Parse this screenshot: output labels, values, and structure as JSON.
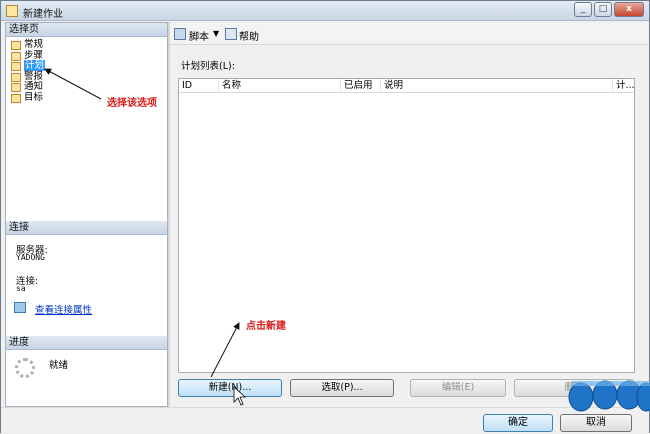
{
  "window": {
    "title": "新建作业"
  },
  "left_pane": {
    "select_page_header": "选择页",
    "pages": [
      {
        "label": "常规",
        "selected": false
      },
      {
        "label": "步骤",
        "selected": false
      },
      {
        "label": "计划",
        "selected": true
      },
      {
        "label": "警报",
        "selected": false
      },
      {
        "label": "通知",
        "selected": false
      },
      {
        "label": "目标",
        "selected": false
      }
    ],
    "connection_header": "连接",
    "server_label": "服务器:",
    "server_value": "YADONG",
    "connection_label": "连接:",
    "connection_value": "sa",
    "view_connection_link": "查看连接属性",
    "progress_header": "进度",
    "progress_status": "就绪"
  },
  "toolbar": {
    "script_label": "脚本",
    "help_label": "帮助"
  },
  "main": {
    "list_label": "计划列表(L):",
    "columns": [
      "ID",
      "名称",
      "已启用",
      "说明",
      "计..."
    ],
    "buttons": {
      "new": "新建(N)...",
      "pick": "选取(P)...",
      "edit": "编辑(E)",
      "delete": "删除"
    }
  },
  "footer": {
    "ok": "确定",
    "cancel": "取消"
  },
  "annotations": {
    "select_option": "选择该选项",
    "click_new": "点击新建"
  },
  "colors": {
    "selection": "#3399ff",
    "annotation": "#d81b1b",
    "link": "#0033cc"
  }
}
